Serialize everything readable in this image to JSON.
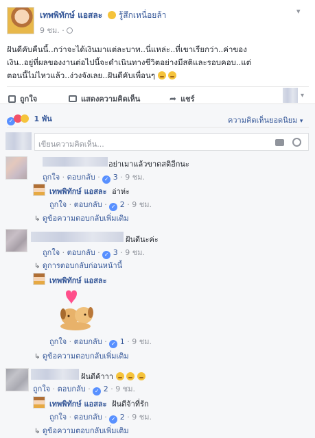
{
  "post": {
    "author": "เทพพิทักษ์ แอสละ",
    "feeling": "รู้สึกเหนื่อยล้า",
    "time": "9 ชม.",
    "separator": "·",
    "text_line1": "ฝันดีคับคืนนี้..กว่าจะได้เงินมาแต่ละบาท..นี่แหล่ะ..ที่เขาเรียกว่า..ค่าของ",
    "text_line2": "เงิน..อยู่ที่ผลของงานต่อไปนี้จะดำเนินทางชีวิตอย่างมีสติและรอบคอบ..แต่",
    "text_line3": "ตอนนี้ไม่ไหวแล้ว..ง่วงจังเลย..ฝันดีคับเพื่อนๆ"
  },
  "actions": {
    "like": "ถูกใจ",
    "comment": "แสดงความคิดเห็น",
    "share": "แชร์"
  },
  "reactions": {
    "count": "1 พัน",
    "sort_label": "ความคิดเห็นยอดนิยม"
  },
  "composer": {
    "placeholder": "เขียนความคิดเห็น..."
  },
  "comments": [
    {
      "text": "อย่าเมาแล้วขาดสติอีกนะ",
      "like": "ถูกใจ",
      "reply": "ตอบกลับ",
      "reactions": "3",
      "time": "9 ชม.",
      "reply_item": {
        "author": "เทพพิทักษ์ แอสละ",
        "text": "อ่าห่ะ",
        "like": "ถูกใจ",
        "reply": "ตอบกลับ",
        "reactions": "2",
        "time": "9 ชม."
      },
      "more": "ดูข้อความตอบกลับเพิ่มเติม"
    },
    {
      "text": "ฝันดีนะค่ะ",
      "like": "ถูกใจ",
      "reply": "ตอบกลับ",
      "reactions": "3",
      "time": "9 ชม.",
      "prev": "ดูการตอบกลับก่อนหน้านี้",
      "reply_item": {
        "author": "เทพพิทักษ์ แอสละ",
        "like": "ถูกใจ",
        "reply": "ตอบกลับ",
        "reactions": "1",
        "time": "9 ชม."
      },
      "more": "ดูข้อความตอบกลับเพิ่มเติม"
    },
    {
      "text": "ฝันดีค้าาา",
      "like": "ถูกใจ",
      "reply": "ตอบกลับ",
      "reactions": "2",
      "time": "9 ชม.",
      "reply_item": {
        "author": "เทพพิทักษ์ แอสละ",
        "text": "ฝันดีจ้าที่รัก",
        "like": "ถูกใจ",
        "reply": "ตอบกลับ",
        "reactions": "2",
        "time": "9 ชม."
      },
      "more": "ดูข้อความตอบกลับเพิ่มเติม"
    }
  ],
  "colors": {
    "link": "#365899",
    "muted": "#90949c",
    "like_blue": "#5890ff",
    "love_red": "#f25268",
    "haha_yellow": "#f5c33b"
  }
}
